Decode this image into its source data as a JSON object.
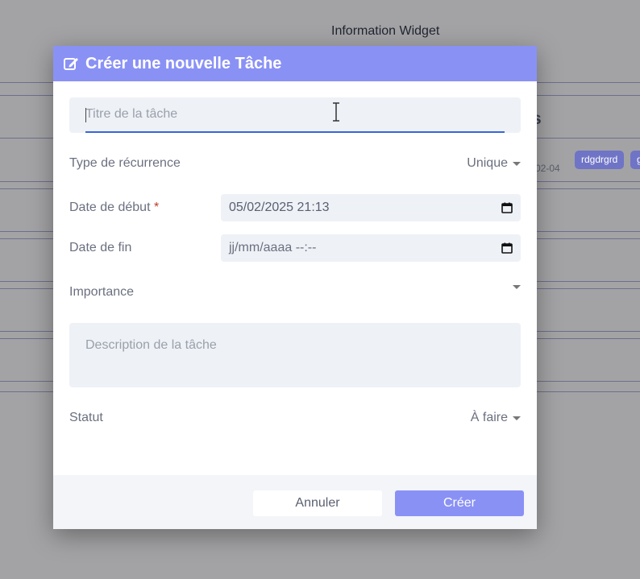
{
  "background": {
    "widget_title": "Information Widget",
    "heading_fragment": "s",
    "date_fragment": "02-04",
    "tags": [
      "rdgdrgrd",
      "g"
    ]
  },
  "modal": {
    "title": "Créer une nouvelle Tâche",
    "title_placeholder": "Titre de la tâche",
    "recurrence": {
      "label": "Type de récurrence",
      "value": "Unique"
    },
    "start_date": {
      "label": "Date de début",
      "required_mark": "*",
      "value": "05/02/2025 21:13"
    },
    "end_date": {
      "label": "Date de fin",
      "placeholder": "jj/mm/aaaa --:--"
    },
    "importance": {
      "label": "Importance",
      "value": ""
    },
    "description_placeholder": "Description de la tâche",
    "status": {
      "label": "Statut",
      "value": "À faire"
    },
    "cancel_label": "Annuler",
    "create_label": "Créer"
  },
  "colors": {
    "accent": "#8a91f5",
    "input_bg": "#eef1f6",
    "overlay": "#a3a3a5",
    "focus_underline": "#3a66d8",
    "required": "#c0392b"
  },
  "icons": {
    "header": "edit-icon",
    "date": "calendar-icon",
    "select": "caret-down-icon"
  }
}
